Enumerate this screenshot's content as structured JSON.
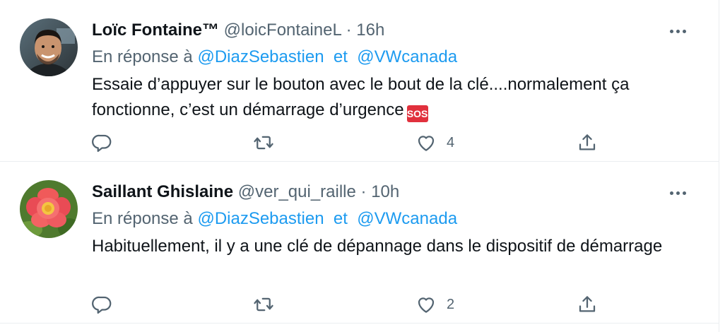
{
  "tweets": [
    {
      "author_name": "Loïc Fontaine™",
      "handle": "@loicFontaineL",
      "separator": "·",
      "time": "16h",
      "reply_prefix": "En réponse à",
      "reply_to_1": "@DiazSebastien",
      "reply_conjunction": "et",
      "reply_to_2": "@VWcanada",
      "text": "Essaie d’appuyer sur le bouton avec le bout de la clé....normalement ça fonctionne, c’est un démarrage d’urgence",
      "emoji": "SOS",
      "reply_count": "",
      "retweet_count": "",
      "like_count": "4",
      "avatar_icon": "person-photo-avatar"
    },
    {
      "author_name": "Saillant Ghislaine",
      "handle": "@ver_qui_raille",
      "separator": "·",
      "time": "10h",
      "reply_prefix": "En réponse à",
      "reply_to_1": "@DiazSebastien",
      "reply_conjunction": "et",
      "reply_to_2": "@VWcanada",
      "text": "Habituellement, il y a une clé de dépannage dans le dispositif de démarrage",
      "reply_count": "",
      "retweet_count": "",
      "like_count": "2",
      "avatar_icon": "flower-photo-avatar"
    }
  ],
  "colors": {
    "link": "#1d9bf0",
    "secondary_text": "#536471",
    "primary_text": "#0f1419",
    "sos_badge": "#e1313d"
  }
}
